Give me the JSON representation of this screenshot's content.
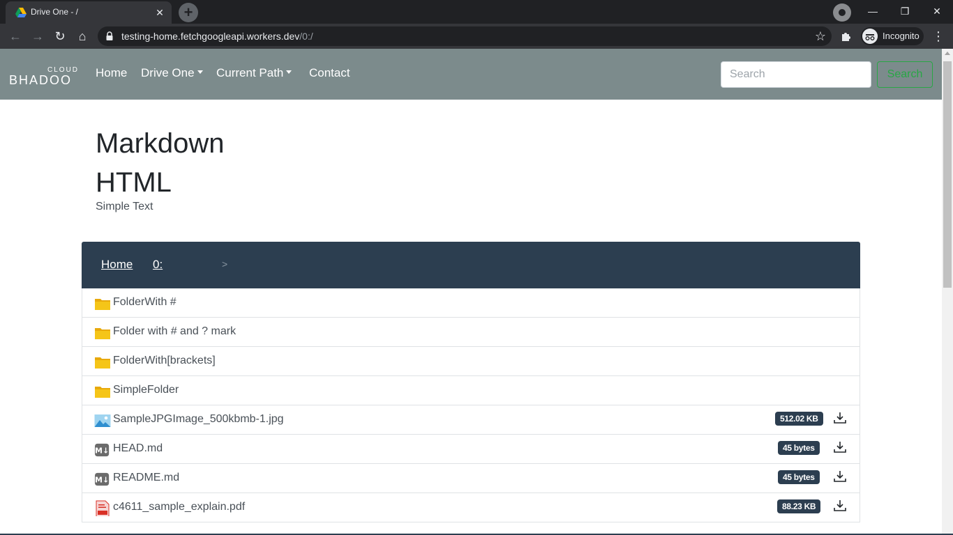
{
  "browser": {
    "tab_title": "Drive One - /",
    "tab_close": "✕",
    "new_tab": "+",
    "window_minimize": "—",
    "window_restore": "❐",
    "window_close": "✕",
    "back": "←",
    "forward": "→",
    "reload": "↻",
    "home": "⌂",
    "url_host": "testing-home.fetchgoogleapi.workers.dev",
    "url_path": "/0:/",
    "bookmark_star": "☆",
    "incognito_label": "Incognito",
    "menu": "⋮"
  },
  "site": {
    "brand_small": "CLOUD",
    "brand_main": "BHADOO",
    "nav": {
      "home": "Home",
      "drive_one": "Drive One",
      "current_path": "Current Path",
      "contact": "Contact"
    },
    "search_placeholder": "Search",
    "search_button": "Search"
  },
  "readme": {
    "heading1": "Markdown",
    "heading2": "HTML",
    "text": "Simple Text"
  },
  "breadcrumb": {
    "home": "Home",
    "separator": ">",
    "current": "0:"
  },
  "files": [
    {
      "name": "FolderWith #",
      "type": "folder"
    },
    {
      "name": "Folder with # and ? mark",
      "type": "folder"
    },
    {
      "name": "FolderWith[brackets]",
      "type": "folder"
    },
    {
      "name": "SimpleFolder",
      "type": "folder"
    },
    {
      "name": "SampleJPGImage_500kbmb-1.jpg",
      "type": "image",
      "size": "512.02 KB"
    },
    {
      "name": "HEAD.md",
      "type": "markdown",
      "size": "45 bytes"
    },
    {
      "name": "README.md",
      "type": "markdown",
      "size": "45 bytes"
    },
    {
      "name": "c4611_sample_explain.pdf",
      "type": "pdf",
      "size": "88.23 KB"
    }
  ],
  "colors": {
    "navbar": "#7c8b8c",
    "breadcrumb": "#2c3e50",
    "badge": "#2c3e50",
    "search_button": "#28a745",
    "folder": "#f5c518"
  }
}
